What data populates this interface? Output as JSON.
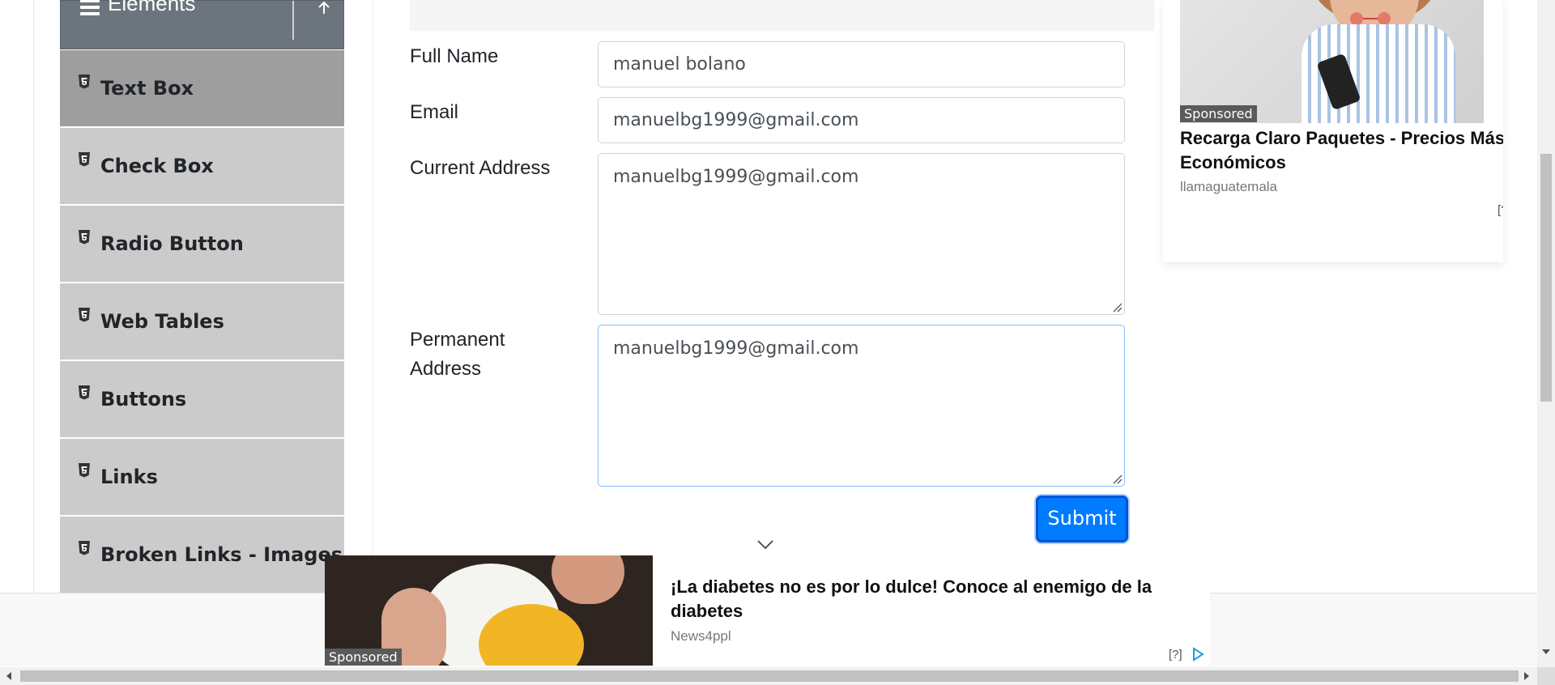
{
  "sidebar": {
    "group_title": "Elements",
    "hamburger_icon": "menu-icon",
    "collapse_icon": "collapse-up-icon",
    "item_icon": "html5-icon",
    "items": [
      {
        "label": "Text Box",
        "active": true
      },
      {
        "label": "Check Box",
        "active": false
      },
      {
        "label": "Radio Button",
        "active": false
      },
      {
        "label": "Web Tables",
        "active": false
      },
      {
        "label": "Buttons",
        "active": false
      },
      {
        "label": "Links",
        "active": false
      },
      {
        "label": "Broken Links - Images",
        "active": false
      }
    ]
  },
  "form": {
    "full_name": {
      "label": "Full Name",
      "value": "manuel bolano"
    },
    "email": {
      "label": "Email",
      "value": "manuelbg1999@gmail.com"
    },
    "current_address": {
      "label": "Current Address",
      "value": "manuelbg1999@gmail.com"
    },
    "permanent_address": {
      "label_line1": "Permanent",
      "label_line2": "Address",
      "value": "manuelbg1999@gmail.com"
    },
    "submit_label": "Submit"
  },
  "ads": {
    "right": {
      "badge": "Sponsored",
      "title": "Recarga Claro Paquetes - Precios Más Económicos",
      "source": "llamaguatemala",
      "info": "[?]"
    },
    "bottom": {
      "badge": "Sponsored",
      "title": "¡La diabetes no es por lo dulce! Conoce al enemigo de la diabetes",
      "source": "News4ppl",
      "info": "[?]"
    }
  },
  "colors": {
    "accent": "#007bff",
    "sidebar_header": "#6c757d",
    "sidebar_item": "#cbcbcb",
    "sidebar_item_active": "#9e9e9e"
  }
}
